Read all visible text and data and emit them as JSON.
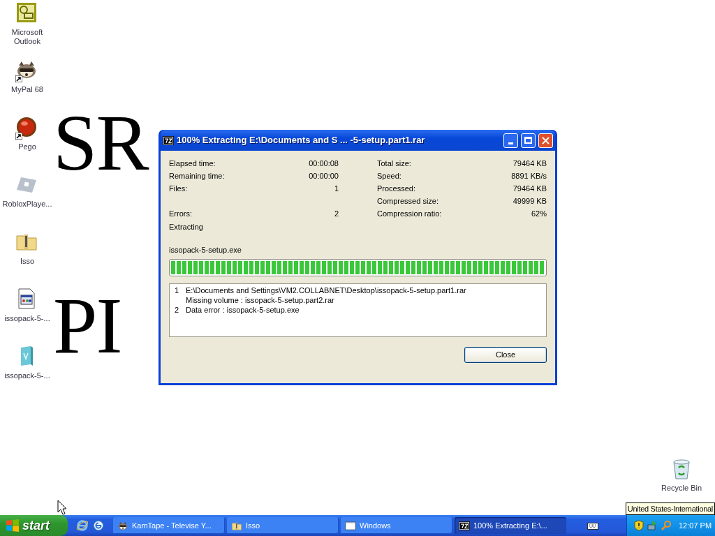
{
  "desktop": {
    "wallpaper_lines": [
      "SR",
      "PI"
    ],
    "icons": [
      {
        "label": "Microsoft Outlook",
        "kind": "outlook",
        "shortcut": false
      },
      {
        "label": "MyPal 68",
        "kind": "raccoon",
        "shortcut": true
      },
      {
        "label": "Pego",
        "kind": "orb",
        "shortcut": true
      },
      {
        "label": "RobloxPlaye...",
        "kind": "tile",
        "shortcut": false
      },
      {
        "label": "Isso",
        "kind": "zipfolder",
        "shortcut": false
      },
      {
        "label": "issopack-5-...",
        "kind": "document",
        "shortcut": false
      },
      {
        "label": "issopack-5-...",
        "kind": "installer",
        "shortcut": false
      }
    ],
    "recycle_bin": {
      "label": "Recycle Bin"
    }
  },
  "dialog": {
    "title": "100% Extracting E:\\Documents and S ... -5-setup.part1.rar",
    "left_stat_groups": [
      [
        {
          "label": "Elapsed time:",
          "value": "00:00:08"
        },
        {
          "label": "Remaining time:",
          "value": "00:00:00"
        },
        {
          "label": "Files:",
          "value": "1"
        }
      ],
      [
        {
          "label": "Errors:",
          "value": "2"
        }
      ]
    ],
    "right_stats": [
      {
        "label": "Total size:",
        "value": "79464 KB"
      },
      {
        "label": "Speed:",
        "value": "8891 KB/s"
      },
      {
        "label": "Processed:",
        "value": "79464 KB"
      },
      {
        "label": "Compressed size:",
        "value": "49999 KB"
      },
      {
        "label": "Compression ratio:",
        "value": "62%"
      }
    ],
    "status": "Extracting",
    "current_file": "issopack-5-setup.exe",
    "progress": {
      "level": 1
    },
    "messages": [
      {
        "number": "1",
        "lines": [
          "E:\\Documents and Settings\\VM2.COLLABNET\\Desktop\\issopack-5-setup.part1.rar",
          "Missing volume : issopack-5-setup.part2.rar"
        ]
      },
      {
        "number": "2",
        "lines": [
          "Data error : issopack-5-setup.exe"
        ]
      }
    ],
    "button": "Close"
  },
  "tooltip": "United States-International",
  "taskbar": {
    "start": "start",
    "quick_launch": [
      {
        "kind": "ie"
      },
      {
        "kind": "ie-alt"
      }
    ],
    "tasks": [
      {
        "label": "KamTape - Televise Y...",
        "kind": "raccoon",
        "selected": false
      },
      {
        "label": "Isso",
        "kind": "zipfolder",
        "selected": false
      },
      {
        "label": "Windows",
        "kind": "window",
        "selected": false
      },
      {
        "label": "100% Extracting E:\\...",
        "kind": "sevenzip",
        "selected": true
      }
    ],
    "clock": "12:07 PM"
  }
}
